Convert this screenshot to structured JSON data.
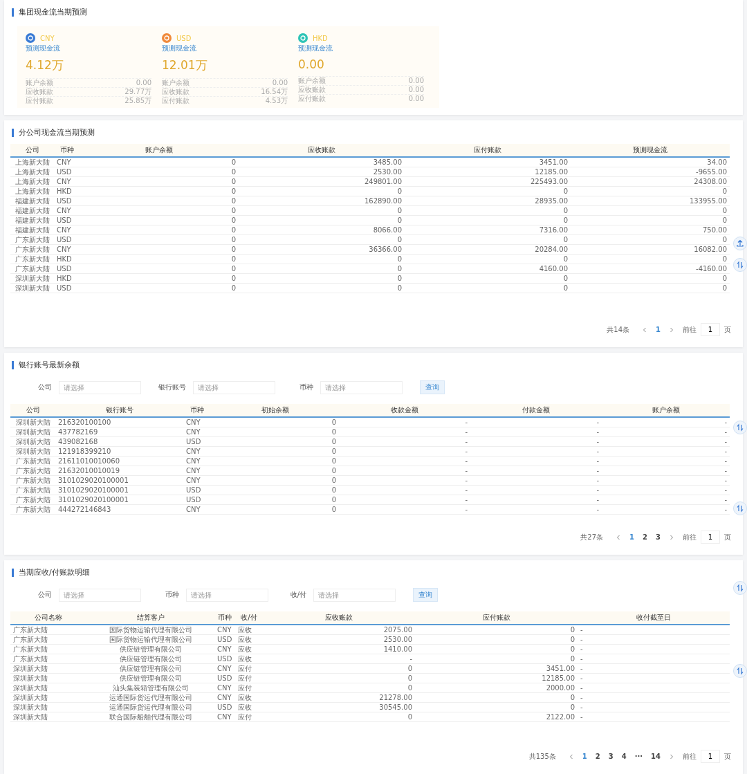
{
  "group_forecast": {
    "title": "集团现金流当期预测",
    "cards": [
      {
        "currency": "CNY",
        "color": "#3a7bd5",
        "label": "预测现金流",
        "amount": "4.12万",
        "rows": [
          {
            "label": "账户余额",
            "value": "0.00"
          },
          {
            "label": "应收账款",
            "value": "29.77万"
          },
          {
            "label": "应付账款",
            "value": "25.85万"
          }
        ]
      },
      {
        "currency": "USD",
        "color": "#f08a3c",
        "label": "预测现金流",
        "amount": "12.01万",
        "rows": [
          {
            "label": "账户余额",
            "value": "0.00"
          },
          {
            "label": "应收账款",
            "value": "16.54万"
          },
          {
            "label": "应付账款",
            "value": "4.53万"
          }
        ]
      },
      {
        "currency": "HKD",
        "color": "#2ec4b6",
        "label": "预测现金流",
        "amount": "0.00",
        "rows": [
          {
            "label": "账户余额",
            "value": "0.00"
          },
          {
            "label": "应收账款",
            "value": "0.00"
          },
          {
            "label": "应付账款",
            "value": "0.00"
          }
        ]
      }
    ]
  },
  "branch_forecast": {
    "title": "分公司现金流当期预测",
    "columns": [
      "公司",
      "币种",
      "账户余额",
      "应收账款",
      "应付账款",
      "预测现金流"
    ],
    "rows": [
      [
        "上海新大陆",
        "CNY",
        "0",
        "3485.00",
        "3451.00",
        "34.00"
      ],
      [
        "上海新大陆",
        "USD",
        "0",
        "2530.00",
        "12185.00",
        "-9655.00"
      ],
      [
        "上海新大陆",
        "CNY",
        "0",
        "249801.00",
        "225493.00",
        "24308.00"
      ],
      [
        "上海新大陆",
        "HKD",
        "0",
        "0",
        "0",
        "0"
      ],
      [
        "福建新大陆",
        "USD",
        "0",
        "162890.00",
        "28935.00",
        "133955.00"
      ],
      [
        "福建新大陆",
        "CNY",
        "0",
        "0",
        "0",
        "0"
      ],
      [
        "福建新大陆",
        "USD",
        "0",
        "0",
        "0",
        "0"
      ],
      [
        "福建新大陆",
        "CNY",
        "0",
        "8066.00",
        "7316.00",
        "750.00"
      ],
      [
        "广东新大陆",
        "USD",
        "0",
        "0",
        "0",
        "0"
      ],
      [
        "广东新大陆",
        "CNY",
        "0",
        "36366.00",
        "20284.00",
        "16082.00"
      ],
      [
        "广东新大陆",
        "HKD",
        "0",
        "0",
        "0",
        "0"
      ],
      [
        "广东新大陆",
        "USD",
        "0",
        "0",
        "4160.00",
        "-4160.00"
      ],
      [
        "深圳新大陆",
        "HKD",
        "0",
        "0",
        "0",
        "0"
      ],
      [
        "深圳新大陆",
        "USD",
        "0",
        "0",
        "0",
        "0"
      ]
    ],
    "pagination": {
      "total": "共14条",
      "pages": [
        {
          "label": "1",
          "selected": true
        }
      ],
      "goto": "前往",
      "page_input": "1",
      "suffix": "页"
    }
  },
  "bank_balance": {
    "title": "银行账号最新余额",
    "filters": [
      {
        "label": "公司",
        "placeholder": "请选择"
      },
      {
        "label": "银行账号",
        "placeholder": "请选择"
      },
      {
        "label": "币种",
        "placeholder": "请选择"
      }
    ],
    "query_button": "查询",
    "columns": [
      "公司",
      "银行账号",
      "币种",
      "初始余额",
      "收款金额",
      "付款金额",
      "账户余额"
    ],
    "rows": [
      [
        "深圳新大陆",
        "216320100100",
        "CNY",
        "0",
        "-",
        "-",
        "-"
      ],
      [
        "深圳新大陆",
        "437782169",
        "CNY",
        "0",
        "-",
        "-",
        "-"
      ],
      [
        "深圳新大陆",
        "439082168",
        "USD",
        "0",
        "-",
        "-",
        "-"
      ],
      [
        "深圳新大陆",
        "121918399210",
        "CNY",
        "0",
        "-",
        "-",
        "-"
      ],
      [
        "广东新大陆",
        "21611010010060",
        "CNY",
        "0",
        "-",
        "-",
        "-"
      ],
      [
        "广东新大陆",
        "21632010010019",
        "CNY",
        "0",
        "-",
        "-",
        "-"
      ],
      [
        "广东新大陆",
        "3101029020100001",
        "CNY",
        "0",
        "-",
        "-",
        "-"
      ],
      [
        "广东新大陆",
        "3101029020100001",
        "USD",
        "0",
        "-",
        "-",
        "-"
      ],
      [
        "广东新大陆",
        "3101029020100001",
        "USD",
        "0",
        "-",
        "-",
        "-"
      ],
      [
        "广东新大陆",
        "444272146843",
        "CNY",
        "0",
        "-",
        "-",
        "-"
      ]
    ],
    "pagination": {
      "total": "共27条",
      "pages": [
        {
          "label": "1",
          "selected": true
        },
        {
          "label": "2",
          "selected": false
        },
        {
          "label": "3",
          "selected": false
        }
      ],
      "goto": "前往",
      "page_input": "1",
      "suffix": "页"
    }
  },
  "period_detail": {
    "title": "当期应收/付账款明细",
    "filters": [
      {
        "label": "公司",
        "placeholder": "请选择"
      },
      {
        "label": "币种",
        "placeholder": "请选择"
      },
      {
        "label": "收/付",
        "placeholder": "请选择"
      }
    ],
    "query_button": "查询",
    "columns": [
      "公司名称",
      "结算客户",
      "币种",
      "收/付",
      "应收账款",
      "应付账款",
      "收付截至日"
    ],
    "rows": [
      [
        "广东新大陆",
        "国际货物运输代理有限公司",
        "CNY",
        "应收",
        "2075.00",
        "0",
        "-"
      ],
      [
        "广东新大陆",
        "国际货物运输代理有限公司",
        "USD",
        "应收",
        "2530.00",
        "0",
        "-"
      ],
      [
        "广东新大陆",
        "供应链管理有限公司",
        "CNY",
        "应收",
        "1410.00",
        "0",
        "-"
      ],
      [
        "广东新大陆",
        "供应链管理有限公司",
        "USD",
        "应收",
        "-",
        "0",
        "-"
      ],
      [
        "深圳新大陆",
        "供应链管理有限公司",
        "CNY",
        "应付",
        "0",
        "3451.00",
        "-"
      ],
      [
        "深圳新大陆",
        "供应链管理有限公司",
        "USD",
        "应付",
        "0",
        "12185.00",
        "-"
      ],
      [
        "深圳新大陆",
        "汕头集装箱管理有限公司",
        "CNY",
        "应付",
        "0",
        "2000.00",
        "-"
      ],
      [
        "深圳新大陆",
        "运通国际货运代理有限公司",
        "CNY",
        "应收",
        "21278.00",
        "0",
        "-"
      ],
      [
        "深圳新大陆",
        "运通国际货运代理有限公司",
        "USD",
        "应收",
        "30545.00",
        "0",
        "-"
      ],
      [
        "深圳新大陆",
        "联合国际船舶代理有限公司",
        "CNY",
        "应付",
        "0",
        "2122.00",
        "-"
      ]
    ],
    "pagination": {
      "total": "共135条",
      "pages": [
        {
          "label": "1",
          "selected": true
        },
        {
          "label": "2",
          "selected": false
        },
        {
          "label": "3",
          "selected": false
        },
        {
          "label": "4",
          "selected": false
        },
        {
          "label": "···",
          "selected": false
        },
        {
          "label": "14",
          "selected": false
        }
      ],
      "goto": "前往",
      "page_input": "1",
      "suffix": "页"
    }
  }
}
